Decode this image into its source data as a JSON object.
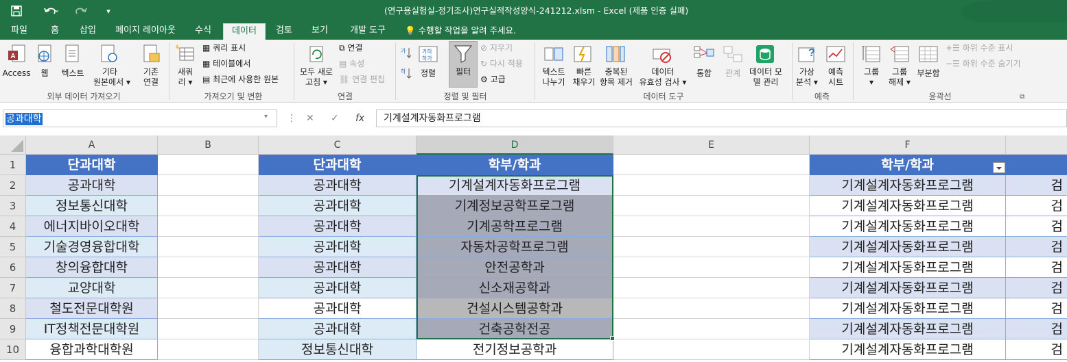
{
  "window": {
    "title": "(연구용실험실-정기조사)연구실적작성양식-241212.xlsm - Excel (제품 인증 실패)"
  },
  "quick_access": {
    "save_icon": "save-icon",
    "undo_icon": "undo-icon",
    "redo_icon": "redo-icon",
    "customize_icon": "customize-icon"
  },
  "tabs": [
    "파일",
    "홈",
    "삽입",
    "페이지 레이아웃",
    "수식",
    "데이터",
    "검토",
    "보기",
    "개발 도구"
  ],
  "active_tab": "데이터",
  "tell_me": "수행할 작업을 알려 주세요.",
  "ribbon": {
    "ext": {
      "access": "Access",
      "web": "웹",
      "text": "텍스트",
      "other_1": "기타",
      "other_2": "원본에서 ▾",
      "existing_1": "기존",
      "existing_2": "연결",
      "group": "외부 데이터 가져오기"
    },
    "transform": {
      "newquery_1": "새쿼",
      "newquery_2": "리 ▾",
      "show_query": "쿼리 표시",
      "from_table": "테이블에서",
      "recent": "최근에 사용한 원본",
      "group": "가져오기 및 변환"
    },
    "connections": {
      "refresh_1": "모두 새로",
      "refresh_2": "고침 ▾",
      "connections": "연결",
      "properties": "속성",
      "edit_links": "연결 편집",
      "group": "연결"
    },
    "sort": {
      "sort": "정렬",
      "filter": "필터",
      "clear": "지우기",
      "reapply": "다시 적용",
      "advanced": "고급",
      "group": "정렬 및 필터"
    },
    "tools": {
      "text_to_col_1": "텍스트",
      "text_to_col_2": "나누기",
      "flash_1": "빠른",
      "flash_2": "채우기",
      "dup_1": "중복된",
      "dup_2": "항목 제거",
      "valid_1": "데이터",
      "valid_2": "유효성 검사 ▾",
      "consolidate": "통합",
      "relations": "관계",
      "model_1": "데이터 모",
      "model_2": "델 관리",
      "group": "데이터 도구"
    },
    "forecast": {
      "whatif_1": "가상",
      "whatif_2": "분석 ▾",
      "sheet_1": "예측",
      "sheet_2": "시트",
      "group": "예측"
    },
    "outline": {
      "group_1": "그룹",
      "group_2": "▾",
      "ungroup_1": "그룹",
      "ungroup_2": "해제 ▾",
      "subtotal": "부분합",
      "show_detail": "하위 수준 표시",
      "hide_detail": "하위 수준 숨기기",
      "group": "윤곽선"
    }
  },
  "name_box": "공과대학",
  "formula_bar": {
    "cancel": "✕",
    "enter": "✓",
    "fx": "fx",
    "value": "기계설계자동화프로그램"
  },
  "columns": [
    "A",
    "B",
    "C",
    "D",
    "E",
    "F"
  ],
  "rows": [
    "1",
    "2",
    "3",
    "4",
    "5",
    "6",
    "7",
    "8",
    "9",
    "10"
  ],
  "sheet": {
    "A": [
      "단과대학",
      "공과대학",
      "정보통신대학",
      "에너지바이오대학",
      "기술경영융합대학",
      "창의융합대학",
      "교양대학",
      "철도전문대학원",
      "IT정책전문대학원",
      "융합과학대학원"
    ],
    "C": [
      "단과대학",
      "공과대학",
      "공과대학",
      "공과대학",
      "공과대학",
      "공과대학",
      "공과대학",
      "공과대학",
      "공과대학",
      "정보통신대학"
    ],
    "D": [
      "학부/학과",
      "기계설계자동화프로그램",
      "기계정보공학프로그램",
      "기계공학프로그램",
      "자동차공학프로그램",
      "안전공학과",
      "신소재공학과",
      "건설시스템공학과",
      "건축공학전공",
      "전기정보공학과"
    ],
    "F": [
      "학부/학과",
      "기계설계자동화프로그램",
      "기계설계자동화프로그램",
      "기계설계자동화프로그램",
      "기계설계자동화프로그램",
      "기계설계자동화프로그램",
      "기계설계자동화프로그램",
      "기계설계자동화프로그램",
      "기계설계자동화프로그램",
      "기계설계자동화프로그램"
    ],
    "G": [
      "",
      "검",
      "검",
      "검",
      "검",
      "검",
      "검",
      "검",
      "검",
      "검"
    ]
  },
  "colors": {
    "excel_green": "#217346",
    "table_header": "#4472c4",
    "band_light": "#d9e1f2",
    "selection": "#a6a9b8"
  }
}
